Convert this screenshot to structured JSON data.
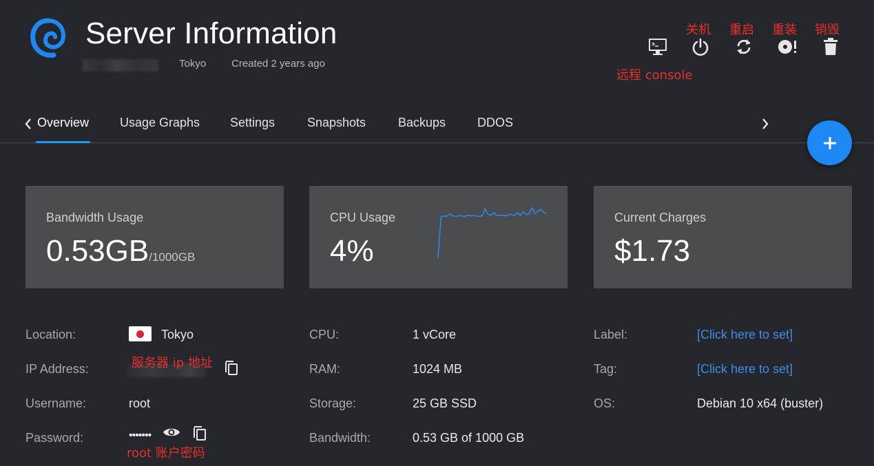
{
  "header": {
    "title": "Server Information",
    "location": "Tokyo",
    "created": "Created 2 years ago",
    "logo": "debian-swirl-logo"
  },
  "actions": [
    {
      "icon": "console-monitor-icon",
      "annotation": "远程 console"
    },
    {
      "icon": "power-icon",
      "annotation": "关机"
    },
    {
      "icon": "restart-icon",
      "annotation": "重启"
    },
    {
      "icon": "reinstall-disc-icon",
      "annotation": "重装"
    },
    {
      "icon": "trash-icon",
      "annotation": "销毁"
    }
  ],
  "tabs": [
    "Overview",
    "Usage Graphs",
    "Settings",
    "Snapshots",
    "Backups",
    "DDOS"
  ],
  "active_tab": "Overview",
  "fab": {
    "label": "+"
  },
  "cards": {
    "bandwidth": {
      "label": "Bandwidth Usage",
      "value": "0.53GB",
      "sub": "/1000GB"
    },
    "cpu": {
      "label": "CPU Usage",
      "value": "4%"
    },
    "charges": {
      "label": "Current Charges",
      "value": "$1.73"
    }
  },
  "details": {
    "location": {
      "label": "Location:",
      "value": "Tokyo"
    },
    "ip": {
      "label": "IP Address:",
      "annotation": "服务器 ip 地址"
    },
    "username": {
      "label": "Username:",
      "value": "root"
    },
    "password": {
      "label": "Password:",
      "value": "•••••••",
      "annotation": "root 账户密码"
    },
    "cpu": {
      "label": "CPU:",
      "value": "1 vCore"
    },
    "ram": {
      "label": "RAM:",
      "value": "1024 MB"
    },
    "storage": {
      "label": "Storage:",
      "value": "25 GB SSD"
    },
    "bandwidth": {
      "label": "Bandwidth:",
      "value": "0.53 GB of 1000 GB"
    },
    "label": {
      "label": "Label:",
      "value": "[Click here to set]"
    },
    "tag": {
      "label": "Tag:",
      "value": "[Click here to set]"
    },
    "os": {
      "label": "OS:",
      "value": "Debian 10 x64 (buster)"
    }
  },
  "colors": {
    "accent": "#2196f3",
    "background": "#25272c",
    "card": "#4b4c4f",
    "annotation": "#e8302a",
    "link": "#3b8fe8"
  },
  "cpu_sparkline": [
    0.02,
    0.78,
    0.8,
    0.79,
    0.84,
    0.8,
    0.79,
    0.8,
    0.8,
    0.79,
    0.81,
    0.8,
    0.8,
    0.8,
    0.79,
    0.8,
    0.93,
    0.83,
    0.81,
    0.86,
    0.8,
    0.81,
    0.81,
    0.8,
    0.82,
    0.83,
    0.8,
    0.86,
    0.81,
    0.88,
    0.82,
    0.84,
    0.95,
    0.84,
    0.89,
    0.92,
    0.86,
    0.84
  ]
}
